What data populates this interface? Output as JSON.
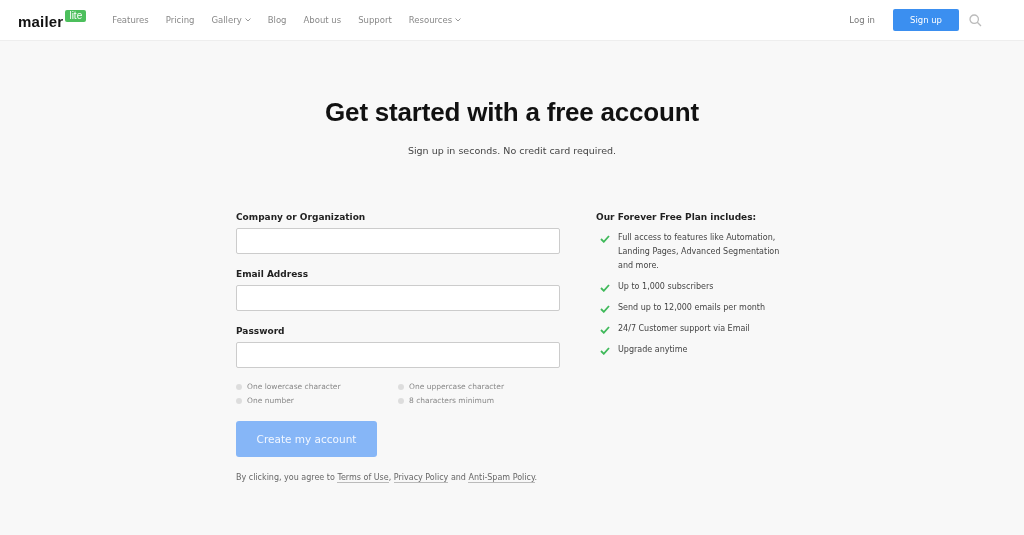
{
  "header": {
    "logo": {
      "word": "mailer",
      "badge": "lite"
    },
    "nav": [
      {
        "label": "Features",
        "dropdown": false
      },
      {
        "label": "Pricing",
        "dropdown": false
      },
      {
        "label": "Gallery",
        "dropdown": true
      },
      {
        "label": "Blog",
        "dropdown": false
      },
      {
        "label": "About us",
        "dropdown": false
      },
      {
        "label": "Support",
        "dropdown": false
      },
      {
        "label": "Resources",
        "dropdown": true
      }
    ],
    "login": "Log in",
    "signup": "Sign up"
  },
  "title": "Get started with a free account",
  "subtitle": "Sign up in seconds. No credit card required.",
  "form": {
    "fields": [
      {
        "label": "Company or Organization"
      },
      {
        "label": "Email Address"
      },
      {
        "label": "Password"
      }
    ],
    "rules": [
      {
        "text": "One lowercase character",
        "met": false
      },
      {
        "text": "One uppercase character",
        "met": false
      },
      {
        "text": "One number",
        "met": false
      },
      {
        "text": "8 characters minimum",
        "met": false
      }
    ],
    "submit": {
      "label": "Create my account",
      "disabled": true
    },
    "agreement": [
      {
        "kind": "text",
        "text": "By clicking, you agree to "
      },
      {
        "kind": "link",
        "text": "Terms of Use"
      },
      {
        "kind": "text",
        "text": ", "
      },
      {
        "kind": "link",
        "text": "Privacy Policy"
      },
      {
        "kind": "text",
        "text": " and "
      },
      {
        "kind": "link",
        "text": "Anti-Spam Policy"
      },
      {
        "kind": "text",
        "text": "."
      }
    ]
  },
  "plan": {
    "heading": "Our Forever Free Plan includes:",
    "features": [
      "Full access to features like Automation, Landing Pages, Advanced Segmentation and more.",
      "Up to 1,000 subscribers",
      "Send up to 12,000 emails per month",
      "24/7 Customer support via Email",
      "Upgrade anytime"
    ]
  }
}
